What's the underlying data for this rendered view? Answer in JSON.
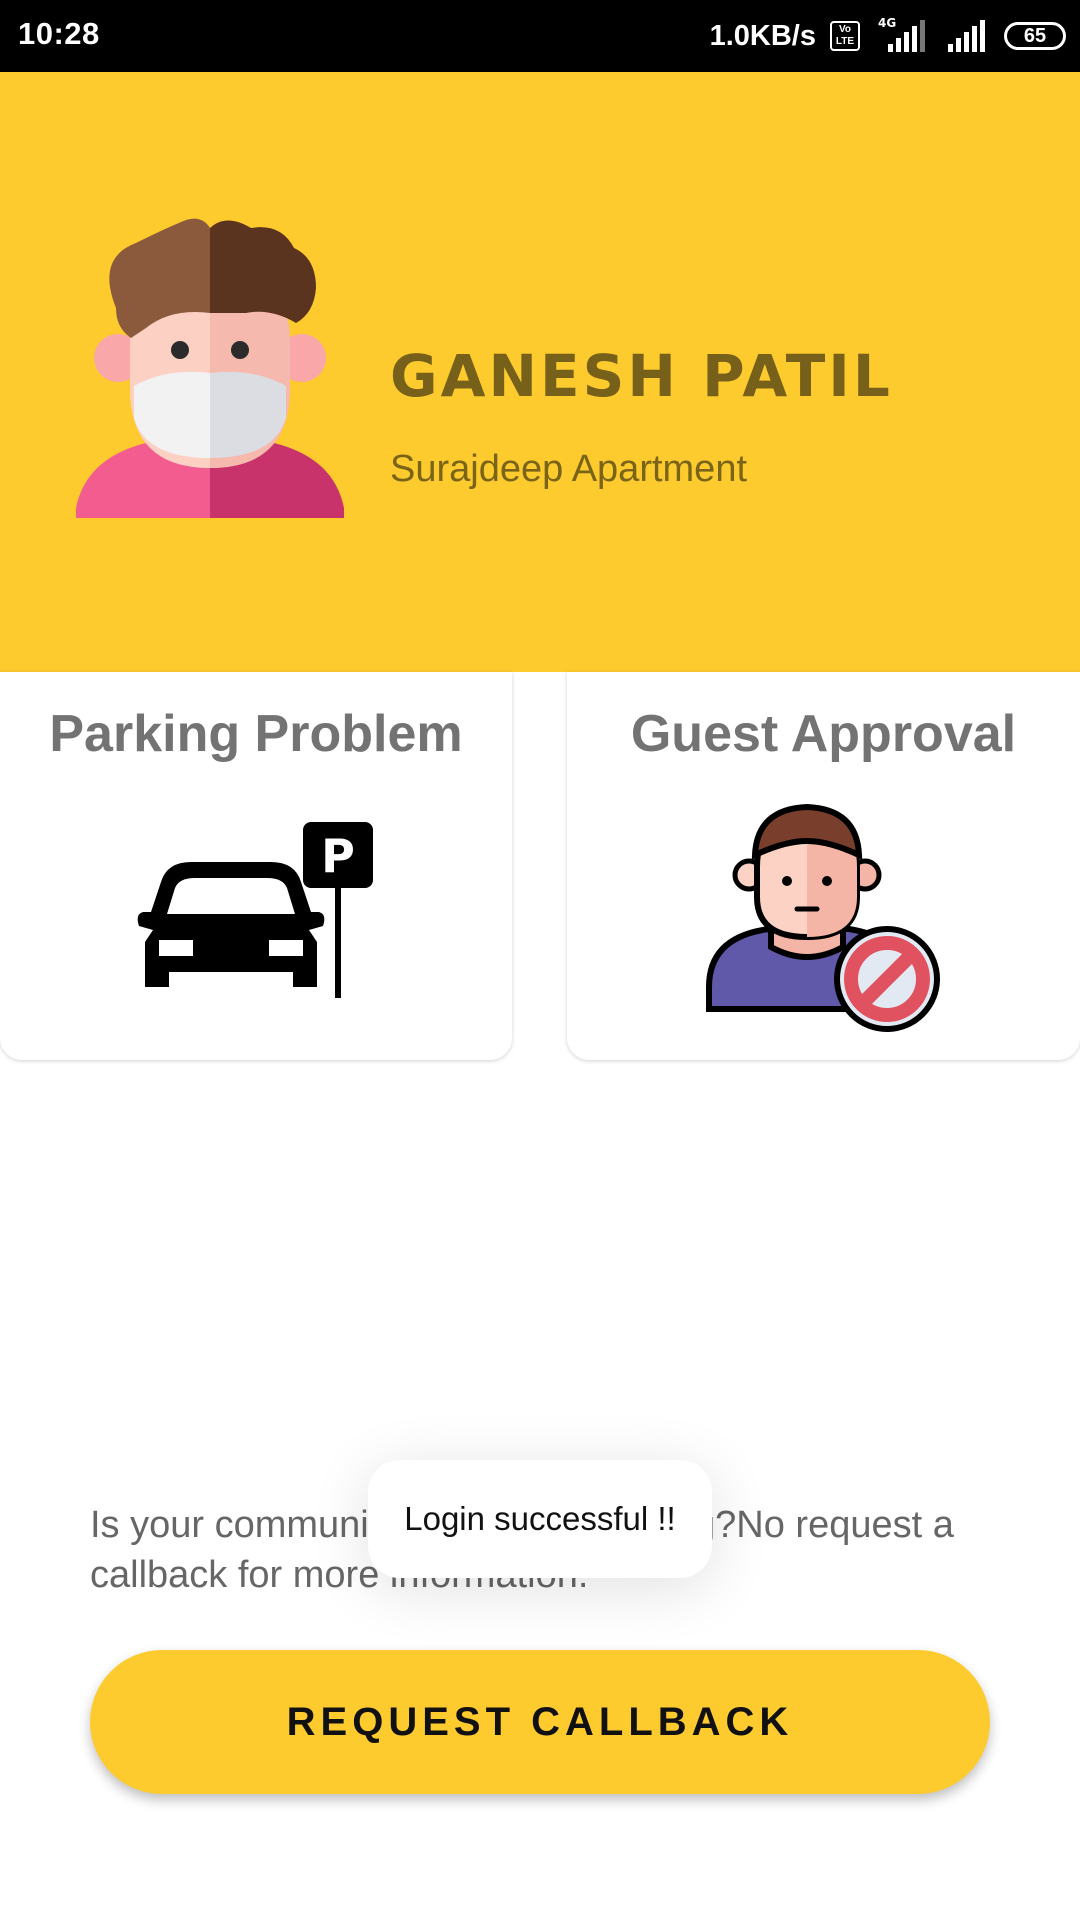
{
  "status_bar": {
    "time": "10:28",
    "net_speed": "1.0KB/s",
    "volte": "Vo LTE",
    "network": "4G",
    "battery": "65"
  },
  "profile": {
    "name": "GANESH PATIL",
    "apartment": "Surajdeep Apartment"
  },
  "cards": [
    {
      "title": "Parking Problem",
      "icon": "car-parking-icon"
    },
    {
      "title": "Guest Approval",
      "icon": "guest-denied-icon"
    }
  ],
  "callback": {
    "text": "Is your community using this Building?No request a callback for more information.",
    "button_label": "REQUEST CALLBACK"
  },
  "toast": {
    "message": "Login successful !!"
  },
  "colors": {
    "accent": "#fdcb2e",
    "name_text": "#76601a",
    "card_title": "#737373"
  }
}
